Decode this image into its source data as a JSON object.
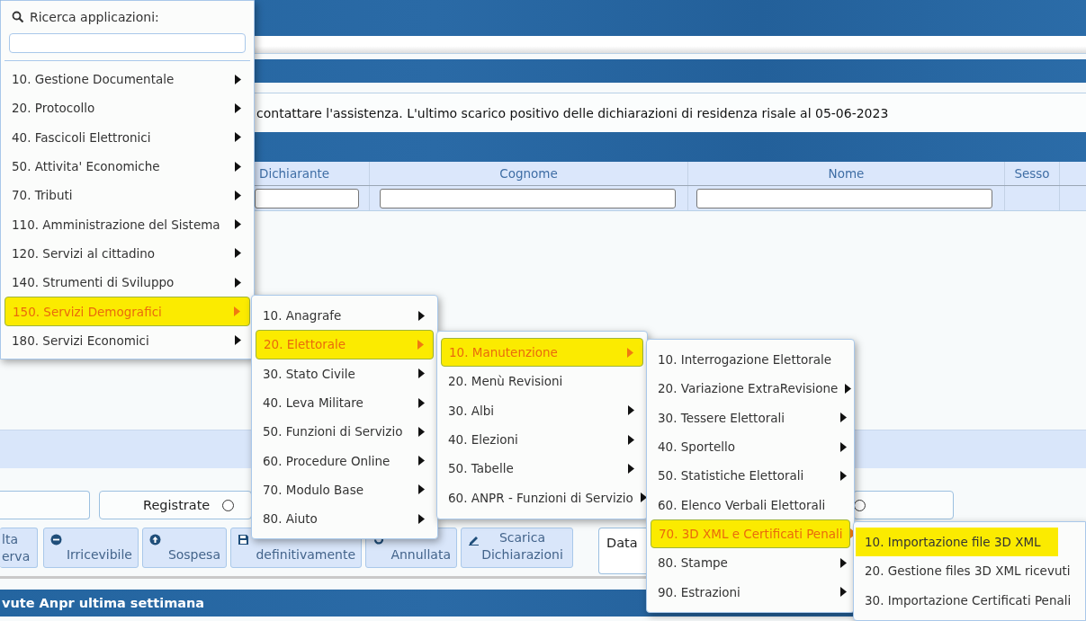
{
  "page": {
    "message": "contattare l'assistenza. L'ultimo scarico positivo delle dichiarazioni di residenza risale al 05-06-2023",
    "table": {
      "columns": [
        "Dichiarante",
        "Cognome",
        "Nome",
        "Sesso"
      ]
    },
    "radio_fields": [
      {
        "label": "Registrate",
        "checked": false
      },
      {
        "checked": false
      }
    ],
    "buttons": [
      {
        "label": "lta\nerva"
      },
      {
        "label": "Irricevibile"
      },
      {
        "label": "Sospesa"
      },
      {
        "label": "definitivamente"
      },
      {
        "label": "Annullata"
      },
      {
        "label": "Scarica\nDichiarazioni"
      }
    ],
    "date_field": {
      "label": "Data"
    },
    "footer_title": "vute Anpr ultima settimana"
  },
  "menus": [
    {
      "search": {
        "label": "Ricerca applicazioni:"
      },
      "items": [
        {
          "label": "10. Gestione Documentale",
          "submenu": true,
          "selected": false
        },
        {
          "label": "20. Protocollo",
          "submenu": true,
          "selected": false
        },
        {
          "label": "40. Fascicoli Elettronici",
          "submenu": true,
          "selected": false
        },
        {
          "label": "50. Attivita' Economiche",
          "submenu": true,
          "selected": false
        },
        {
          "label": "70. Tributi",
          "submenu": true,
          "selected": false
        },
        {
          "label": "110. Amministrazione del Sistema",
          "submenu": true,
          "selected": false
        },
        {
          "label": "120. Servizi al cittadino",
          "submenu": true,
          "selected": false
        },
        {
          "label": "140. Strumenti di Sviluppo",
          "submenu": true,
          "selected": false
        },
        {
          "label": "150. Servizi Demografici",
          "submenu": true,
          "selected": true
        },
        {
          "label": "180. Servizi Economici",
          "submenu": true,
          "selected": false
        }
      ]
    },
    {
      "items": [
        {
          "label": "10. Anagrafe",
          "submenu": true,
          "selected": false
        },
        {
          "label": "20. Elettorale",
          "submenu": true,
          "selected": true
        },
        {
          "label": "30. Stato Civile",
          "submenu": true,
          "selected": false
        },
        {
          "label": "40. Leva Militare",
          "submenu": true,
          "selected": false
        },
        {
          "label": "50. Funzioni di Servizio",
          "submenu": true,
          "selected": false
        },
        {
          "label": "60. Procedure Online",
          "submenu": true,
          "selected": false
        },
        {
          "label": "70. Modulo Base",
          "submenu": true,
          "selected": false
        },
        {
          "label": "80. Aiuto",
          "submenu": true,
          "selected": false
        }
      ]
    },
    {
      "items": [
        {
          "label": "10. Manutenzione",
          "submenu": true,
          "selected": true
        },
        {
          "label": "20. Menù Revisioni",
          "submenu": false,
          "selected": false
        },
        {
          "label": "30. Albi",
          "submenu": true,
          "selected": false
        },
        {
          "label": "40. Elezioni",
          "submenu": true,
          "selected": false
        },
        {
          "label": "50. Tabelle",
          "submenu": true,
          "selected": false
        },
        {
          "label": "60. ANPR - Funzioni di Servizio",
          "submenu": true,
          "selected": false
        }
      ]
    },
    {
      "items": [
        {
          "label": "10. Interrogazione Elettorale",
          "submenu": false,
          "selected": false
        },
        {
          "label": "20. Variazione ExtraRevisione",
          "submenu": true,
          "selected": false
        },
        {
          "label": "30. Tessere Elettorali",
          "submenu": true,
          "selected": false
        },
        {
          "label": "40. Sportello",
          "submenu": true,
          "selected": false
        },
        {
          "label": "50. Statistiche Elettorali",
          "submenu": true,
          "selected": false
        },
        {
          "label": "60. Elenco Verbali Elettorali",
          "submenu": false,
          "selected": false
        },
        {
          "label": "70. 3D XML e Certificati Penali",
          "submenu": true,
          "selected": true
        },
        {
          "label": "80. Stampe",
          "submenu": true,
          "selected": false
        },
        {
          "label": "90. Estrazioni",
          "submenu": true,
          "selected": false
        }
      ]
    },
    {
      "items": [
        {
          "label": "10. Importazione file 3D XML",
          "submenu": false,
          "selected": true
        },
        {
          "label": "20. Gestione files 3D XML ricevuti",
          "submenu": false,
          "selected": false
        },
        {
          "label": "30. Importazione Certificati Penali",
          "submenu": false,
          "selected": false
        }
      ]
    }
  ]
}
